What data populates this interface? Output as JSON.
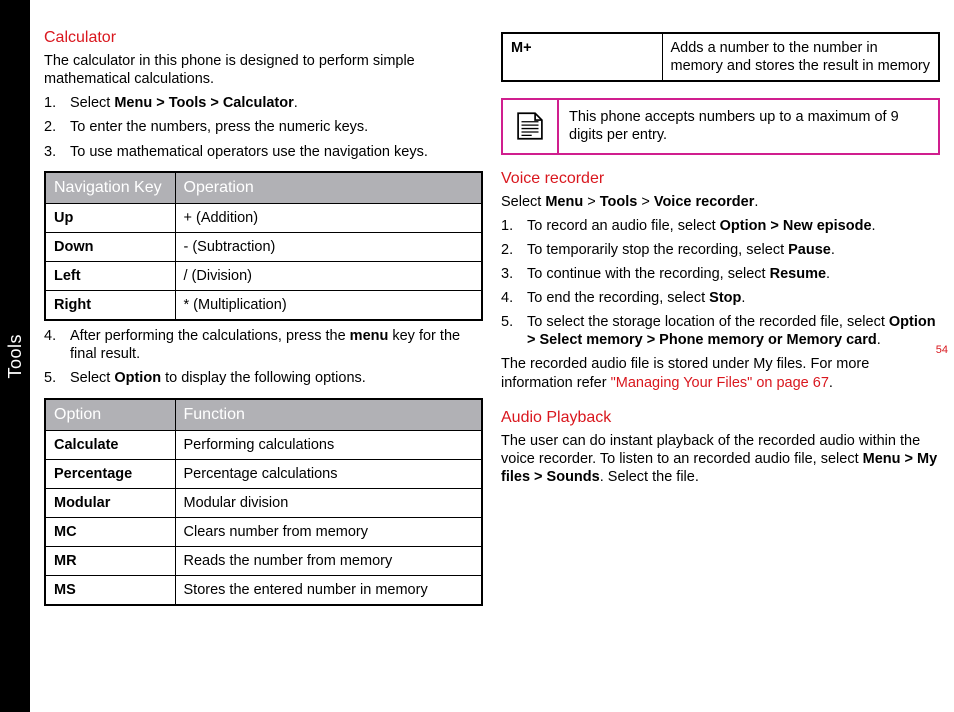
{
  "sidebar": {
    "label": "Tools"
  },
  "page_number": "54",
  "left": {
    "calculator": {
      "title": "Calculator",
      "intro": "The calculator in this phone is designed to perform simple mathematical calculations.",
      "steps": {
        "s1n": "1.",
        "s1a": "Select ",
        "s1b": "Menu > Tools > Calculator",
        "s1c": ".",
        "s2n": "2.",
        "s2": "To enter the numbers, press the numeric keys.",
        "s3n": "3.",
        "s3": "To use mathematical operators use the navigation keys.",
        "s4n": "4.",
        "s4a": "After performing the calculations, press the ",
        "s4b": "menu",
        "s4c": " key for the final result.",
        "s5n": "5.",
        "s5a": "Select ",
        "s5b": "Option",
        "s5c": " to display the following options."
      },
      "nav_table": {
        "h1": "Navigation Key",
        "h2": "Operation",
        "r1k": "Up",
        "r1v": "+ (Addition)",
        "r2k": "Down",
        "r2v": "- (Subtraction)",
        "r3k": "Left",
        "r3v": "/ (Division)",
        "r4k": "Right",
        "r4v": "* (Multiplication)"
      },
      "opt_table": {
        "h1": "Option",
        "h2": "Function",
        "r1k": "Calculate",
        "r1v": "Performing calculations",
        "r2k": "Percentage",
        "r2v": "Percentage calculations",
        "r3k": "Modular",
        "r3v": "Modular division",
        "r4k": "MC",
        "r4v": "Clears number from memory",
        "r5k": "MR",
        "r5v": "Reads the number from memory",
        "r6k": "MS",
        "r6v": "Stores the entered number in memory"
      }
    }
  },
  "right": {
    "mplus": {
      "k": "M+",
      "v": "Adds a number to the number in memory and stores the result in memory"
    },
    "note": "This phone accepts numbers up to a maximum of 9 digits per entry.",
    "voice": {
      "title": "Voice recorder",
      "lead_a": "Select ",
      "lead_b": "Menu",
      "lead_c": " > ",
      "lead_d": "Tools",
      "lead_e": " > ",
      "lead_f": "Voice recorder",
      "lead_g": ".",
      "s1n": "1.",
      "s1a": "To record an audio file, select ",
      "s1b": "Option > New episode",
      "s1c": ".",
      "s2n": "2.",
      "s2a": "To temporarily stop the recording, select ",
      "s2b": "Pause",
      "s2c": ".",
      "s3n": "3.",
      "s3a": "To continue with the recording, select ",
      "s3b": "Resume",
      "s3c": ".",
      "s4n": "4.",
      "s4a": "To end the recording, select ",
      "s4b": "Stop",
      "s4c": ".",
      "s5n": "5.",
      "s5a": "To select the storage location of the recorded file, select ",
      "s5b": "Option > Select memory > Phone memory or Memory card",
      "s5c": ".",
      "tail_a": "The recorded audio file is stored under My files. For more information refer ",
      "tail_xref": "\"Managing Your Files\" on page 67",
      "tail_b": "."
    },
    "audio": {
      "title": "Audio Playback",
      "p_a": "The user can do instant playback of the recorded audio within the voice recorder. To listen to an recorded audio file, select ",
      "p_b": "Menu > My files > Sounds",
      "p_c": ". Select the file."
    }
  }
}
